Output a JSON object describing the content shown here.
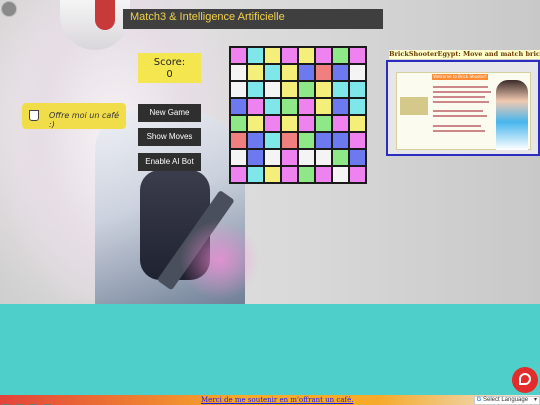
{
  "header": {
    "title": "Match3 & Intelligence Artificielle"
  },
  "score": {
    "label": "Score:",
    "value": "0"
  },
  "buttons": {
    "new_game": "New Game",
    "show_moves": "Show Moves",
    "enable_ai": "Enable AI Bot"
  },
  "coffee_button": {
    "label": "Offre moi un café :)"
  },
  "promo": {
    "title": "BrickShooterEgypt: Move and match bricks to unra",
    "card_heading": "Welcome to Brick Shooter!"
  },
  "footer": {
    "support_text": "Merci de me soutenir en m'offrant un café.",
    "translate_label": "Select Language"
  },
  "colors": {
    "pink": "#ee82ee",
    "yellow": "#f4ef7a",
    "cyan": "#7fe6ea",
    "white": "#f4f4f4",
    "blue": "#6d79ee",
    "green": "#8ee887",
    "salmon": "#f08080",
    "title_text": "#f2d24f",
    "score_bg": "#f4e64e",
    "page_bg": "#4ecfc9"
  },
  "board": {
    "rows": [
      [
        "pink",
        "cyan",
        "yellow",
        "pink",
        "yellow",
        "pink",
        "green",
        "pink"
      ],
      [
        "white",
        "yellow",
        "cyan",
        "yellow",
        "blue",
        "salmon",
        "blue",
        "white"
      ],
      [
        "white",
        "cyan",
        "white",
        "yellow",
        "green",
        "yellow",
        "cyan",
        "cyan"
      ],
      [
        "blue",
        "pink",
        "cyan",
        "green",
        "pink",
        "yellow",
        "blue",
        "cyan"
      ],
      [
        "green",
        "yellow",
        "pink",
        "yellow",
        "pink",
        "green",
        "pink",
        "yellow"
      ],
      [
        "salmon",
        "blue",
        "cyan",
        "salmon",
        "green",
        "blue",
        "blue",
        "pink"
      ],
      [
        "white",
        "blue",
        "white",
        "pink",
        "white",
        "white",
        "green",
        "blue"
      ],
      [
        "pink",
        "cyan",
        "yellow",
        "pink",
        "green",
        "pink",
        "white",
        "pink"
      ]
    ]
  }
}
